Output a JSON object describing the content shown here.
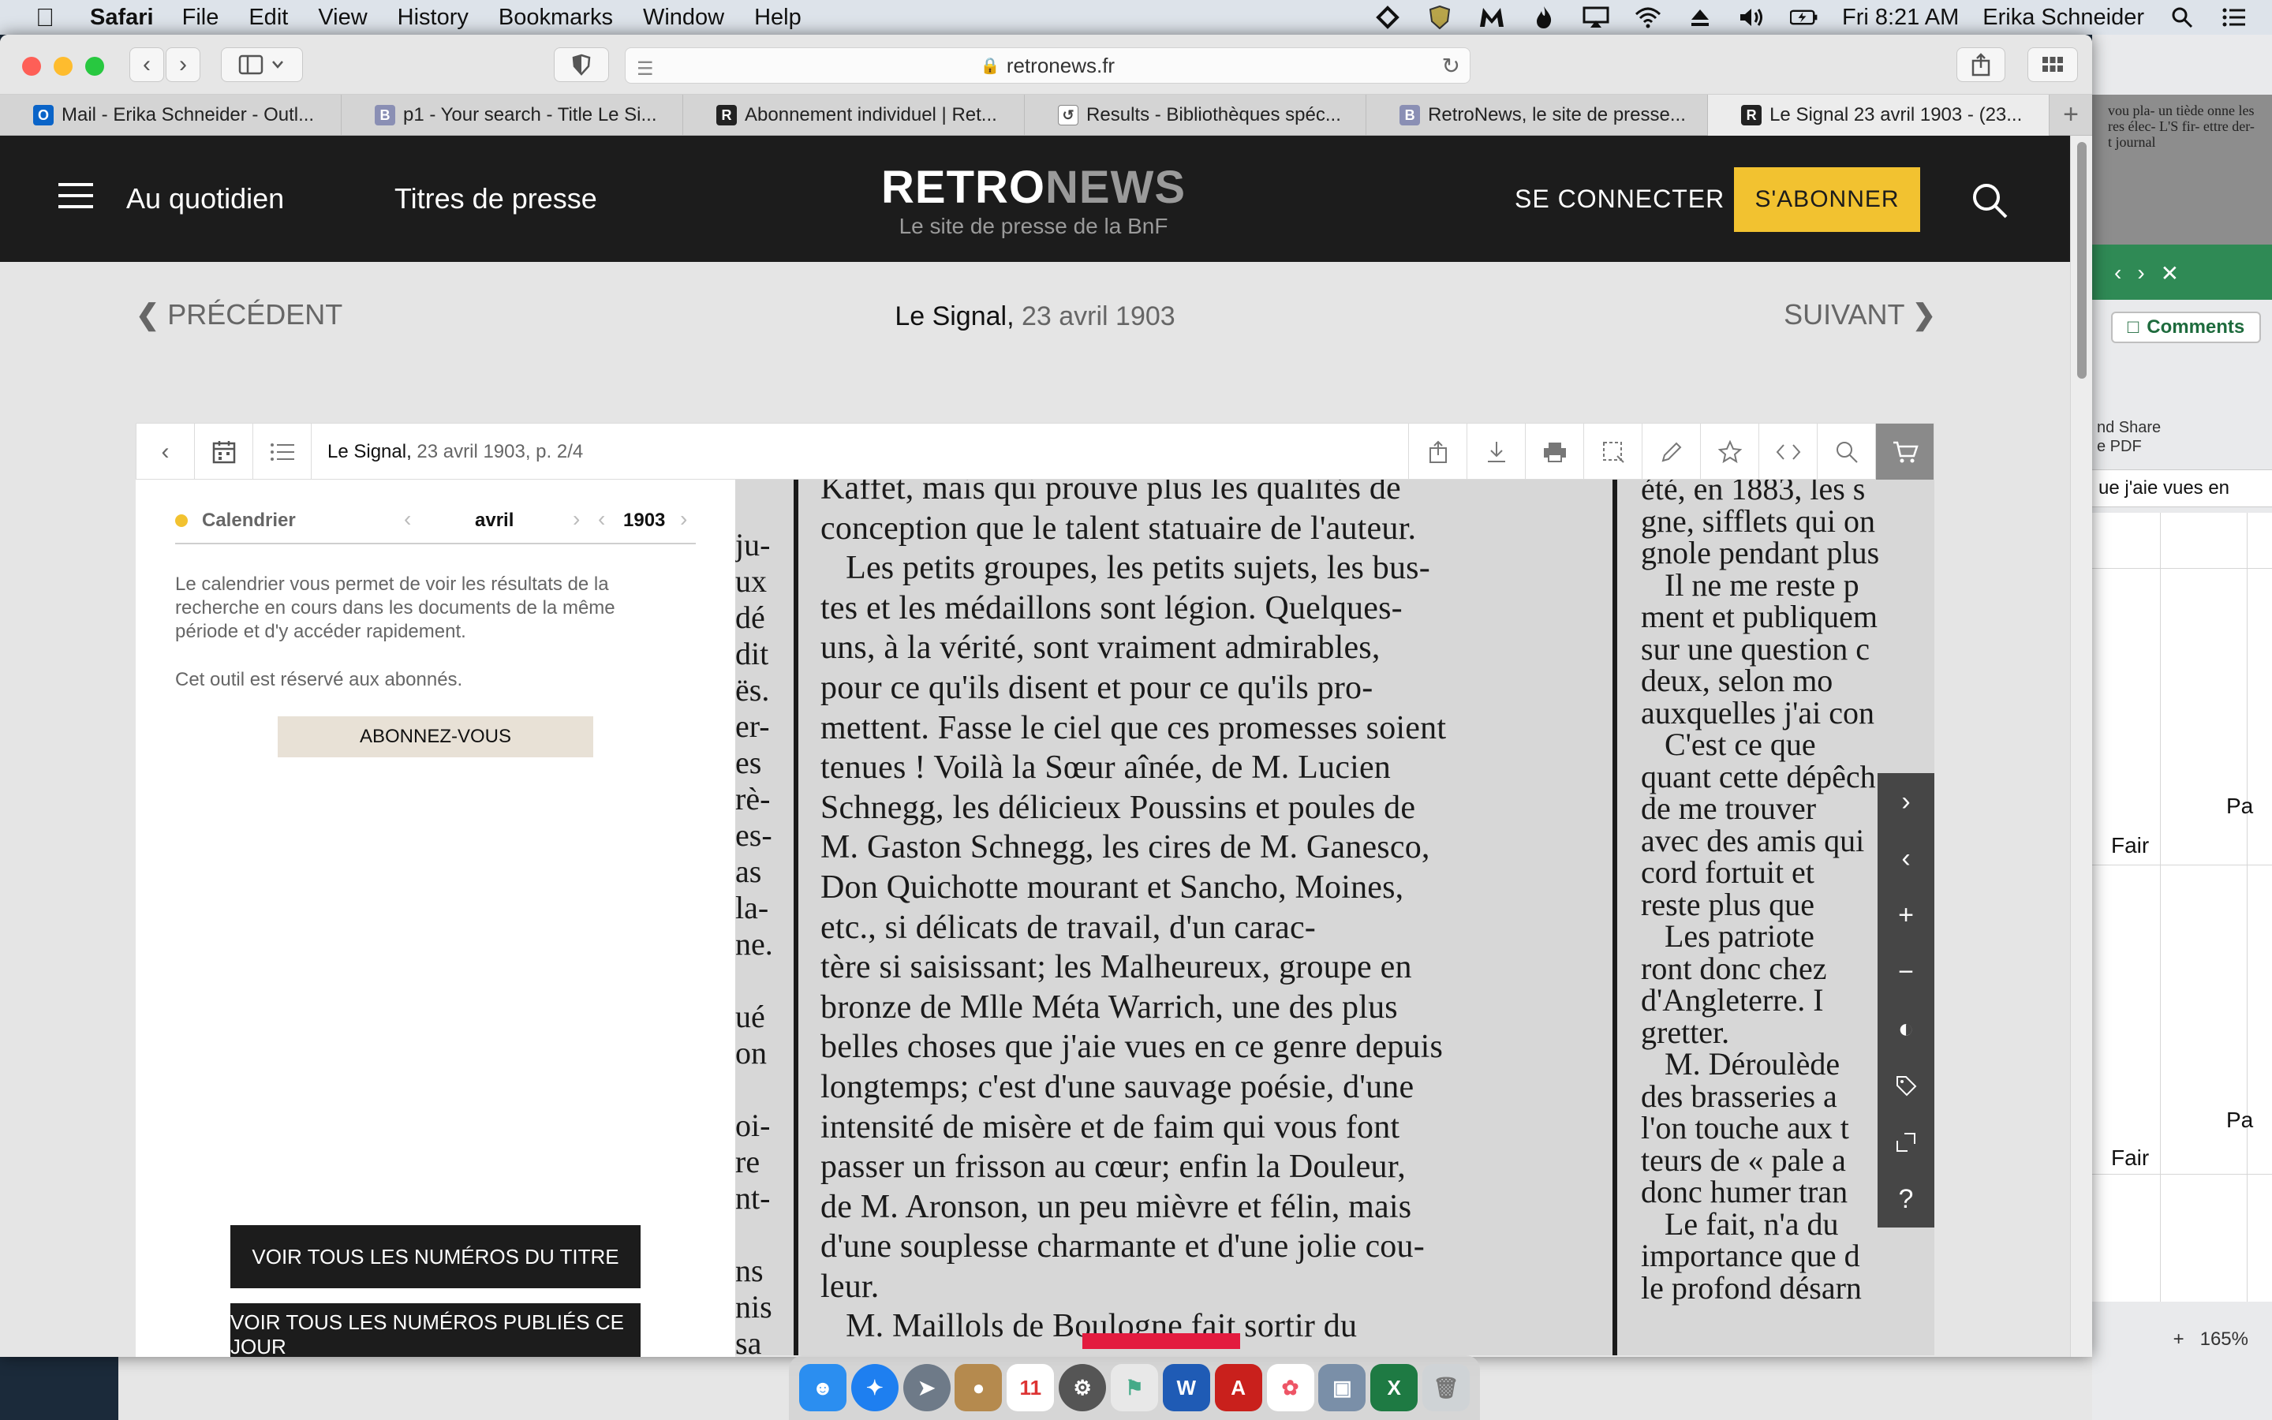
{
  "menubar": {
    "app_name": "Safari",
    "menus": [
      "File",
      "Edit",
      "View",
      "History",
      "Bookmarks",
      "Window",
      "Help"
    ],
    "clock": "Fri 8:21 AM",
    "user": "Erika Schneider"
  },
  "browser": {
    "url": "retronews.fr",
    "edit_label": "Edit",
    "tabs": [
      {
        "title": "Mail - Erika Schneider - Outl...",
        "favicon": "outlook-icon",
        "color": "#0a64c8",
        "letter": "O"
      },
      {
        "title": "p1 - Your search - Title Le Si...",
        "favicon": "b-icon",
        "color": "#8a8fb4",
        "letter": "B"
      },
      {
        "title": "Abonnement individuel | Ret...",
        "favicon": "r-icon",
        "color": "#222222",
        "letter": "R"
      },
      {
        "title": "Results - Bibliothèques spéc...",
        "favicon": "loop-icon",
        "color": "#555555",
        "letter": "↺"
      },
      {
        "title": "RetroNews, le site de presse...",
        "favicon": "b-icon",
        "color": "#8a8fb4",
        "letter": "B"
      },
      {
        "title": "Le Signal 23 avril 1903 - (23...",
        "favicon": "r-icon",
        "color": "#222222",
        "letter": "R"
      }
    ]
  },
  "site": {
    "nav_daily": "Au quotidien",
    "nav_titles": "Titres de presse",
    "logo_a": "RETRO",
    "logo_b": "NEWS",
    "logo_tagline": "Le site de presse de la BnF",
    "login": "SE CONNECTER",
    "subscribe": "S'ABONNER",
    "prev": "PRÉCÉDENT",
    "next": "SUIVANT",
    "doc_title": "Le Signal,",
    "doc_date": "23 avril 1903",
    "viewer_title": "Le Signal,",
    "viewer_sub": "23 avril 1903, p. 2/4"
  },
  "calendar": {
    "label": "Calendrier",
    "month": "avril",
    "year": "1903",
    "description": "Le calendrier vous permet de voir les résultats de la recherche en cours dans les documents de la même période et d'y accéder rapidement.",
    "notice": "Cet outil est réservé aux abonnés.",
    "subscribe_btn": "ABONNEZ-VOUS",
    "all_issues_btn": "VOIR TOUS LES NUMÉROS DU TITRE",
    "same_day_btn": "VOIR TOUS LES NUMÉROS PUBLIÉS CE JOUR"
  },
  "scan": {
    "left_fragments": [
      "ju-",
      "ux",
      "dé",
      "dit",
      "ës.",
      "er-",
      "es",
      "rè-",
      "es-",
      "as",
      "la-",
      "ne.",
      "",
      "ué",
      "on",
      "",
      "oi-",
      "re",
      "nt-",
      "",
      "ns",
      "nis",
      "sa"
    ],
    "main_lines": [
      "Kaffet, mais qui prouve plus les qualités de",
      "conception que le talent statuaire de l'auteur.",
      "   Les petits groupes, les petits sujets, les bus-",
      "tes et les médaillons sont légion. Quelques-",
      "uns, à la vérité, sont vraiment admirables,",
      "pour ce qu'ils disent et pour ce qu'ils pro-",
      "mettent. Fasse le ciel que ces promesses soient",
      "tenues ! Voilà la Sœur aînée, de M. Lucien",
      "Schnegg, les délicieux Poussins et poules de",
      "M. Gaston Schnegg, les cires de M. Ganesco,",
      "Don Quichotte mourant et Sancho, Moines,",
      "etc., si délicats de travail, d'un carac-",
      "tère si saisissant; les Malheureux, groupe en",
      "bronze de Mlle Méta Warrich, une des plus",
      "belles choses que j'aie vues en ce genre depuis",
      "longtemps; c'est d'une sauvage poésie, d'une",
      "intensité de misère et de faim qui vous font",
      "passer un frisson au cœur; enfin la Douleur,",
      "de M. Aronson, un peu mièvre et félin, mais",
      "d'une souplesse charmante et d'une jolie cou-",
      "leur.",
      "   M. Maillols de Boulogne fait sortir du"
    ],
    "right_lines": [
      "été, en 1883, les s",
      "gne, sifflets qui on",
      "gnole pendant plus",
      "   Il ne me reste p",
      "ment et publiquem",
      "sur une question c",
      "deux, selon mo",
      "auxquelles j'ai con",
      "   C'est ce que",
      "quant cette dépêch",
      "de me trouver",
      "avec des amis qui",
      "cord fortuit et",
      "reste plus que",
      "   Les patriote",
      "ront donc chez",
      "d'Angleterre. I",
      "gretter.",
      "   M. Déroulède",
      "des brasseries a",
      "l'on touche aux t",
      "teurs de « pale a",
      "donc humer tran",
      "   Le fait, n'a du",
      "importance que d",
      "le profond désarn"
    ]
  },
  "excel": {
    "comments": "Comments",
    "share": "nd Share\ne PDF",
    "formula_text": "ue j'aie vues en",
    "cells": [
      "Pa",
      "Fair",
      "Pa",
      "Fair"
    ],
    "zoom": "165%"
  },
  "desktop_photo_text": "vou pla-\nun tiède\nonne les\n\nres élec-\nL'S fir-\nettre der-\nt journal"
}
